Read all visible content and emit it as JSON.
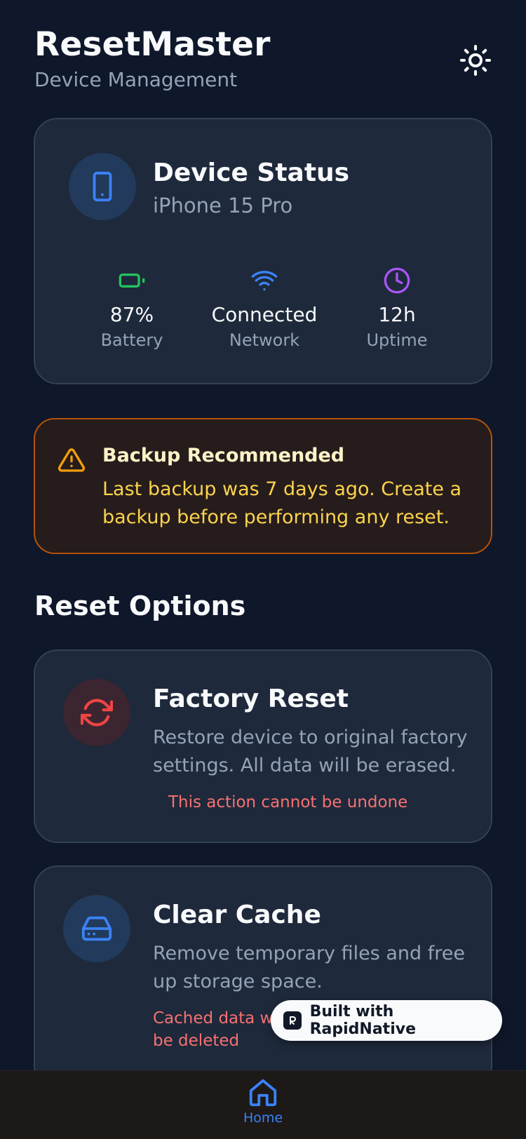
{
  "header": {
    "title": "ResetMaster",
    "subtitle": "Device Management",
    "theme_icon": "sun-icon"
  },
  "device_status": {
    "title": "Device Status",
    "device": "iPhone 15 Pro",
    "icon": "smartphone-icon",
    "stats": [
      {
        "icon": "battery-icon",
        "value": "87%",
        "label": "Battery",
        "color": "#22c55e"
      },
      {
        "icon": "wifi-icon",
        "value": "Connected",
        "label": "Network",
        "color": "#3b82f6"
      },
      {
        "icon": "clock-icon",
        "value": "12h",
        "label": "Uptime",
        "color": "#a855f7"
      }
    ]
  },
  "alert": {
    "icon": "warning-icon",
    "title": "Backup Recommended",
    "text": "Last backup was 7 days ago. Create a backup before performing any reset."
  },
  "reset_options": {
    "title": "Reset Options",
    "items": [
      {
        "icon": "refresh-icon",
        "title": "Factory Reset",
        "description": "Restore device to original factory settings. All data will be erased.",
        "warning": "This action cannot be undone",
        "accent": "#ef4444"
      },
      {
        "icon": "hard-drive-icon",
        "title": "Clear Cache",
        "description": "Remove temporary files and free up storage space.",
        "warning": "Cached data will be deleted",
        "accent": "#3b82f6"
      }
    ]
  },
  "badge": {
    "label": "Built with RapidNative"
  },
  "bottom_nav": {
    "items": [
      {
        "icon": "home-icon",
        "label": "Home",
        "active": true
      }
    ]
  },
  "colors": {
    "background": "#0f172a",
    "card": "#1e293b",
    "primary": "#3b82f6",
    "warning": "#f59e0b",
    "danger": "#ef4444"
  }
}
